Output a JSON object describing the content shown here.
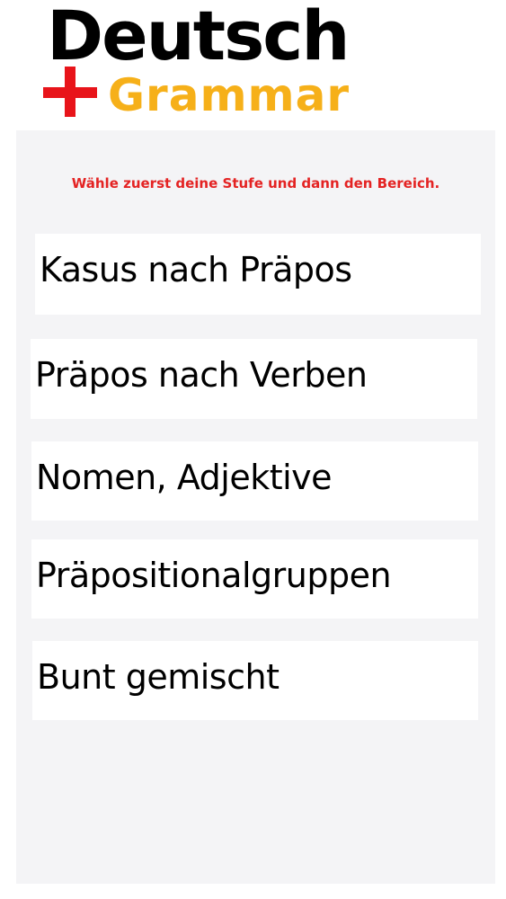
{
  "logo": {
    "word": "Deutsch",
    "sub": "Grammar",
    "colors": {
      "word": "#000000",
      "plus": "#e8141a",
      "sub": "#f6b019"
    }
  },
  "instruction": "Wähle zuerst deine Stufe und dann den Bereich.",
  "menu": {
    "items": [
      {
        "label": "Kasus nach Präpos"
      },
      {
        "label": "Präpos nach Verben"
      },
      {
        "label": "Nomen, Adjektive"
      },
      {
        "label": "Präpositionalgruppen"
      },
      {
        "label": "Bunt gemischt"
      }
    ]
  },
  "colors": {
    "panel_background": "#f4f4f6",
    "instruction_text": "#e42323",
    "item_background": "#ffffff"
  }
}
